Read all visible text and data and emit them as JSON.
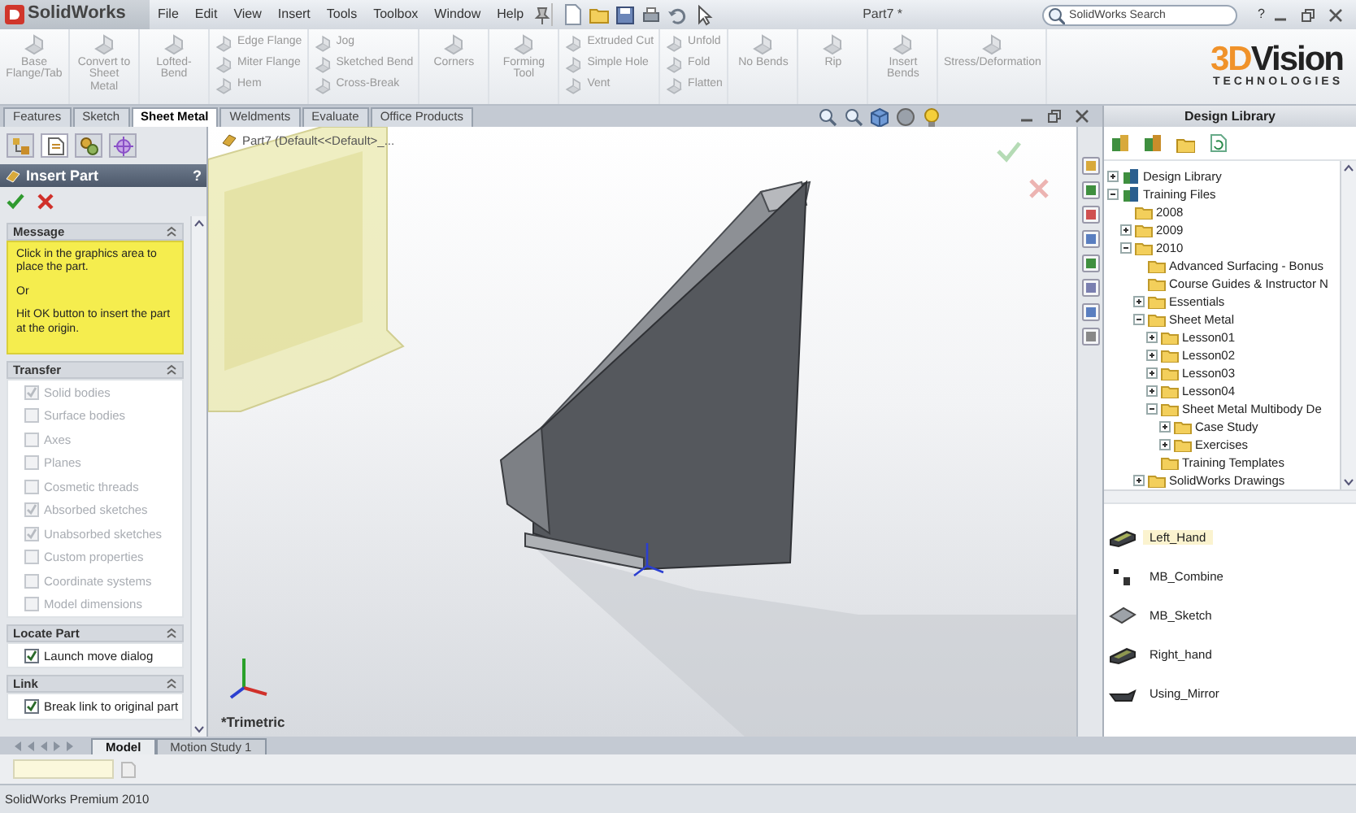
{
  "title_bar": {
    "app_name": "SolidWorks",
    "menu": [
      "File",
      "Edit",
      "View",
      "Insert",
      "Tools",
      "Toolbox",
      "Window",
      "Help"
    ],
    "document_title": "Part7 *",
    "search": {
      "placeholder": "SolidWorks Search"
    },
    "help": "?"
  },
  "ribbon": {
    "groups": [
      {
        "kind": "large",
        "items": [
          {
            "label": "Base Flange/Tab",
            "disabled": true
          }
        ]
      },
      {
        "kind": "large",
        "items": [
          {
            "label": "Convert to Sheet Metal",
            "disabled": true
          }
        ]
      },
      {
        "kind": "large",
        "items": [
          {
            "label": "Lofted-Bend",
            "disabled": true
          }
        ]
      },
      {
        "kind": "stack",
        "items": [
          {
            "label": "Edge Flange",
            "disabled": true
          },
          {
            "label": "Miter Flange",
            "disabled": true
          },
          {
            "label": "Hem",
            "disabled": true
          }
        ]
      },
      {
        "kind": "stack",
        "items": [
          {
            "label": "Jog",
            "disabled": true
          },
          {
            "label": "Sketched Bend",
            "disabled": true
          },
          {
            "label": "Cross-Break",
            "disabled": true
          }
        ]
      },
      {
        "kind": "large",
        "items": [
          {
            "label": "Corners",
            "disabled": true
          }
        ]
      },
      {
        "kind": "large",
        "items": [
          {
            "label": "Forming Tool",
            "disabled": true
          }
        ]
      },
      {
        "kind": "stack",
        "items": [
          {
            "label": "Extruded Cut",
            "disabled": true
          },
          {
            "label": "Simple Hole",
            "disabled": true
          },
          {
            "label": "Vent",
            "disabled": true
          }
        ]
      },
      {
        "kind": "stack",
        "items": [
          {
            "label": "Unfold",
            "disabled": true
          },
          {
            "label": "Fold",
            "disabled": true
          },
          {
            "label": "Flatten",
            "disabled": true
          }
        ]
      },
      {
        "kind": "large",
        "items": [
          {
            "label": "No Bends",
            "disabled": true
          }
        ]
      },
      {
        "kind": "large",
        "items": [
          {
            "label": "Rip",
            "disabled": true
          }
        ]
      },
      {
        "kind": "large",
        "items": [
          {
            "label": "Insert Bends",
            "disabled": true
          }
        ]
      },
      {
        "kind": "large",
        "items": [
          {
            "label": "Stress/Deformation",
            "disabled": true
          }
        ]
      }
    ]
  },
  "logo": {
    "accent": "3D",
    "name": "Vision",
    "tagline": "TECHNOLOGIES"
  },
  "command_tabs": [
    {
      "label": "Features",
      "selected": false
    },
    {
      "label": "Sketch",
      "selected": false
    },
    {
      "label": "Sheet Metal",
      "selected": true
    },
    {
      "label": "Weldments",
      "selected": false
    },
    {
      "label": "Evaluate",
      "selected": false
    },
    {
      "label": "Office Products",
      "selected": false
    }
  ],
  "manager_tabs": [
    {
      "selected": false
    },
    {
      "selected": true
    },
    {
      "selected": false
    },
    {
      "selected": false
    }
  ],
  "property_manager": {
    "title": "Insert Part",
    "help": "?",
    "message": {
      "title": "Message",
      "paragraphs": [
        "Click in the graphics area to place the part.",
        "Or",
        "Hit OK button to insert the part at the origin."
      ]
    },
    "sections": [
      {
        "title": "Transfer",
        "options": [
          {
            "label": "Solid bodies",
            "checked": true,
            "disabled": true
          },
          {
            "label": "Surface bodies",
            "checked": false,
            "disabled": true
          },
          {
            "label": "Axes",
            "checked": false,
            "disabled": true
          },
          {
            "label": "Planes",
            "checked": false,
            "disabled": true
          },
          {
            "label": "Cosmetic threads",
            "checked": false,
            "disabled": true
          },
          {
            "label": "Absorbed sketches",
            "checked": true,
            "disabled": true
          },
          {
            "label": "Unabsorbed sketches",
            "checked": true,
            "disabled": true
          },
          {
            "label": "Custom properties",
            "checked": false,
            "disabled": true
          },
          {
            "label": "Coordinate systems",
            "checked": false,
            "disabled": true
          },
          {
            "label": "Model dimensions",
            "checked": false,
            "disabled": true
          }
        ]
      },
      {
        "title": "Locate Part",
        "options": [
          {
            "label": "Launch move dialog",
            "checked": true,
            "disabled": false
          }
        ]
      },
      {
        "title": "Link",
        "options": [
          {
            "label": "Break link to original part",
            "checked": true,
            "disabled": false
          }
        ]
      }
    ]
  },
  "graphics": {
    "tree_flyout": "Part7  (Default<<Default>_...",
    "view_name": "*Trimetric"
  },
  "design_library": {
    "title": "Design Library",
    "tree": [
      {
        "label": "Design Library",
        "expanded": false
      },
      {
        "label": "Training Files",
        "expanded": true,
        "children": [
          {
            "label": "2008"
          },
          {
            "label": "2009",
            "expanded": false
          },
          {
            "label": "2010",
            "expanded": true,
            "children": [
              {
                "label": "Advanced Surfacing - Bonus"
              },
              {
                "label": "Course Guides & Instructor N"
              },
              {
                "label": "Essentials",
                "expanded": false
              },
              {
                "label": "Sheet Metal",
                "expanded": true,
                "children": [
                  {
                    "label": "Lesson01",
                    "expanded": false
                  },
                  {
                    "label": "Lesson02",
                    "expanded": false
                  },
                  {
                    "label": "Lesson03",
                    "expanded": false
                  },
                  {
                    "label": "Lesson04",
                    "expanded": false
                  },
                  {
                    "label": "Sheet Metal Multibody De",
                    "expanded": true,
                    "children": [
                      {
                        "label": "Case Study",
                        "expanded": false
                      },
                      {
                        "label": "Exercises",
                        "expanded": false
                      }
                    ]
                  },
                  {
                    "label": "Training Templates"
                  }
                ]
              },
              {
                "label": "SolidWorks Drawings",
                "expanded": false
              }
            ]
          }
        ]
      }
    ],
    "files": [
      {
        "label": "Left_Hand",
        "selected": true
      },
      {
        "label": "MB_Combine",
        "selected": false
      },
      {
        "label": "MB_Sketch",
        "selected": false
      },
      {
        "label": "Right_hand",
        "selected": false
      },
      {
        "label": "Using_Mirror",
        "selected": false
      }
    ]
  },
  "bottom_tabs": [
    {
      "label": "Model",
      "selected": true
    },
    {
      "label": "Motion Study 1",
      "selected": false
    }
  ],
  "status_bar": "SolidWorks Premium 2010"
}
